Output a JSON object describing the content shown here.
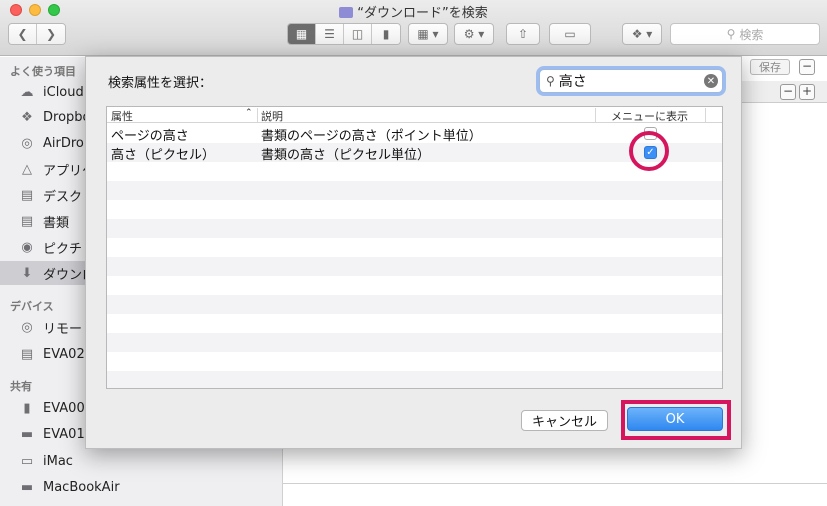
{
  "window": {
    "title": "“ダウンロード”を検索",
    "search_placeholder": "検索",
    "save_label": "保存"
  },
  "sidebar": {
    "favorites_header": "よく使う項目",
    "favorites": [
      {
        "label": "iCloud",
        "icon": "cloud-icon"
      },
      {
        "label": "Dropbo",
        "icon": "dropbox-icon"
      },
      {
        "label": "AirDrop",
        "icon": "airdrop-icon"
      },
      {
        "label": "アプリケ",
        "icon": "applications-icon"
      },
      {
        "label": "デスク",
        "icon": "desktop-icon"
      },
      {
        "label": "書類",
        "icon": "documents-icon"
      },
      {
        "label": "ピクチ",
        "icon": "pictures-icon"
      },
      {
        "label": "ダウンロ",
        "icon": "downloads-icon",
        "selected": true
      }
    ],
    "devices_header": "デバイス",
    "devices": [
      {
        "label": "リモー",
        "icon": "disc-icon"
      },
      {
        "label": "EVA02",
        "icon": "drive-icon"
      }
    ],
    "shared_header": "共有",
    "shared": [
      {
        "label": "EVA00",
        "icon": "server-icon"
      },
      {
        "label": "EVA01",
        "icon": "drive-icon"
      },
      {
        "label": "iMac",
        "icon": "imac-icon"
      },
      {
        "label": "MacBookAir",
        "icon": "laptop-icon"
      }
    ]
  },
  "dialog": {
    "title": "検索属性を選択：",
    "search_value": "高さ",
    "columns": {
      "attribute": "属性",
      "description": "説明",
      "show_in_menu": "メニューに表示"
    },
    "rows": [
      {
        "attribute": "ページの高さ",
        "description": "書類のページの高さ（ポイント単位）",
        "checked": false
      },
      {
        "attribute": "高さ（ピクセル）",
        "description": "書類の高さ（ピクセル単位）",
        "checked": true
      }
    ],
    "cancel_label": "キャンセル",
    "ok_label": "OK"
  },
  "colors": {
    "highlight": "#d5165f",
    "accent": "#3b8ff7"
  }
}
